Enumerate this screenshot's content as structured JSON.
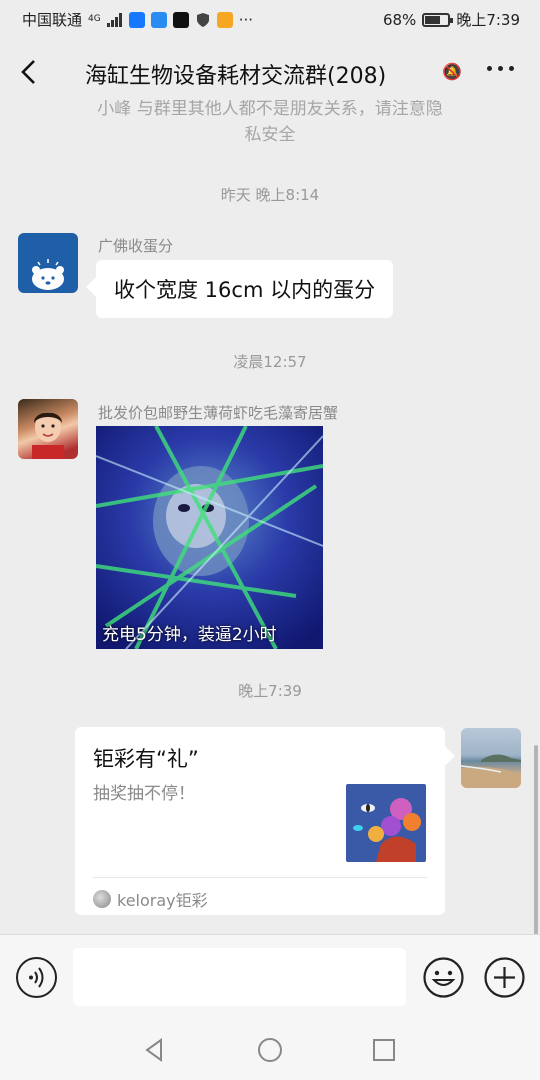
{
  "status_bar": {
    "carrier": "中国联通",
    "network": "4G",
    "battery_percent": "68%",
    "battery_level": 0.68,
    "time": "晚上7:39",
    "more": "···"
  },
  "header": {
    "title": "海缸生物设备耗材交流群(208)"
  },
  "notice": {
    "line1": "小峰 与群里其他人都不是朋友关系，请注意隐",
    "line2": "私安全"
  },
  "messages": [
    {
      "time": "昨天 晚上8:14",
      "sender": "广佛收蛋分",
      "text": "收个宽度 16cm 以内的蛋分"
    },
    {
      "time": "凌晨12:57",
      "sender": "批发价包邮野生薄荷虾吃毛藻寄居蟹",
      "image_caption": "充电5分钟，装逼2小时"
    },
    {
      "time": "晚上7:39",
      "card": {
        "title": "钜彩有“礼”",
        "description": "抽奖抽不停！",
        "source": "keloray钜彩"
      }
    }
  ],
  "colors": {
    "background": "#ededed",
    "bubble": "#ffffff",
    "timestamp": "#999999"
  }
}
